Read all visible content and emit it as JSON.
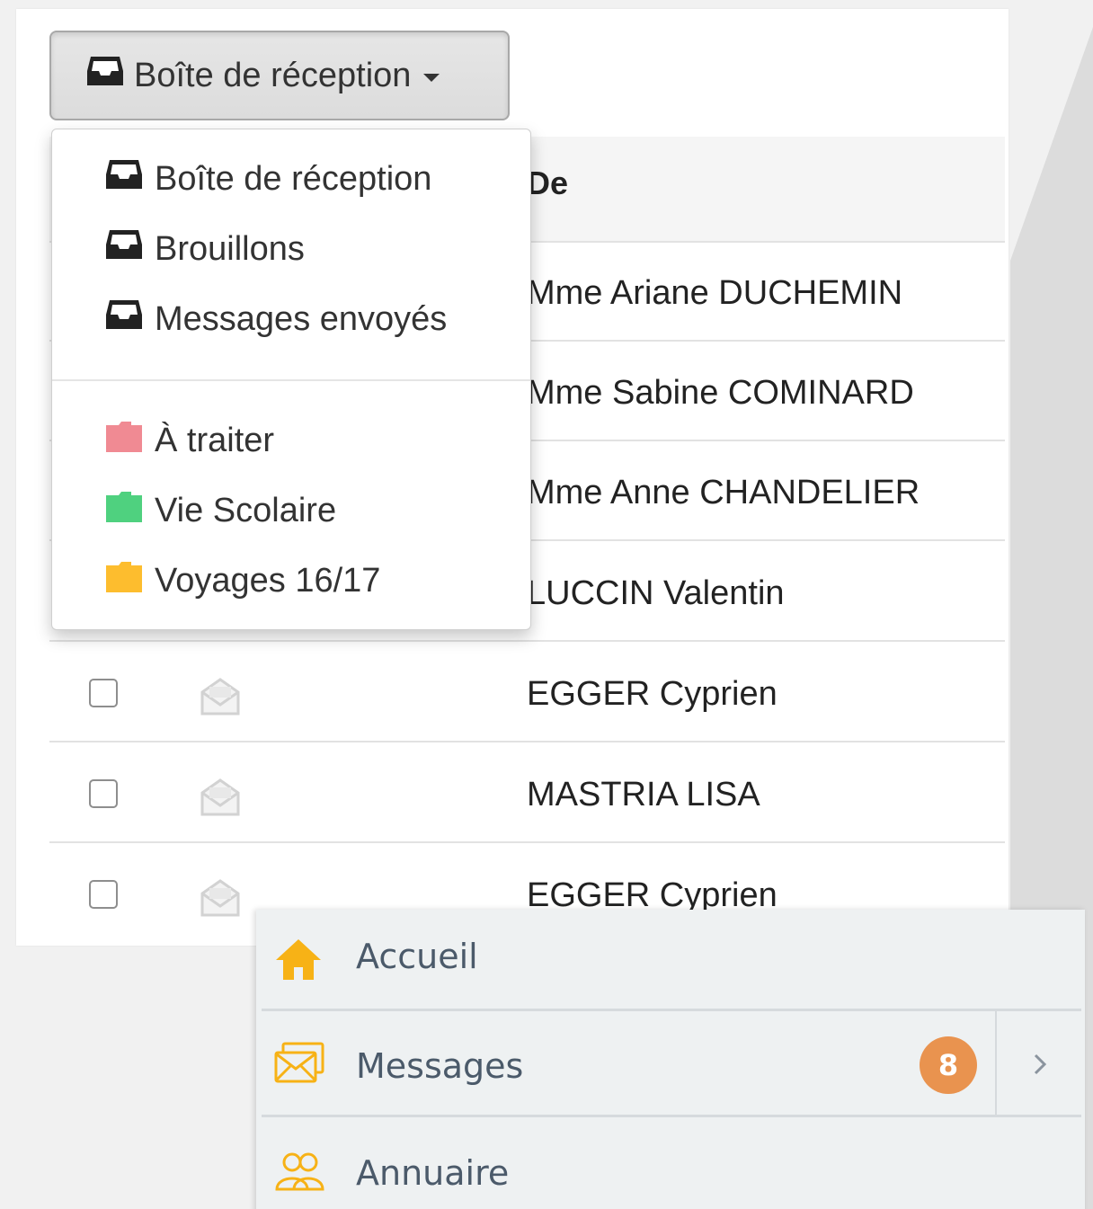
{
  "folder_button": {
    "label": "Boîte de réception"
  },
  "table": {
    "from_header": "De",
    "rows": [
      {
        "from": "Mme Ariane DUCHEMIN"
      },
      {
        "from": "Mme Sabine COMINARD"
      },
      {
        "from": "Mme Anne CHANDELIER"
      },
      {
        "from": "LUCCIN Valentin"
      },
      {
        "from": "EGGER Cyprien"
      },
      {
        "from": "MASTRIA LISA"
      },
      {
        "from": "EGGER Cyprien"
      }
    ]
  },
  "folder_menu": {
    "system_folders": [
      {
        "label": "Boîte de réception",
        "icon": "inbox-icon"
      },
      {
        "label": "Brouillons",
        "icon": "inbox-icon"
      },
      {
        "label": "Messages envoyés",
        "icon": "inbox-icon"
      }
    ],
    "custom_folders": [
      {
        "label": "À traiter",
        "icon": "folder-icon",
        "color": "#f08a93"
      },
      {
        "label": "Vie Scolaire",
        "icon": "folder-icon",
        "color": "#4fd17f"
      },
      {
        "label": "Voyages 16/17",
        "icon": "folder-icon",
        "color": "#fdbd2e"
      }
    ]
  },
  "nav": {
    "items": [
      {
        "label": "Accueil",
        "icon": "home-icon",
        "color": "#f7b216"
      },
      {
        "label": "Messages",
        "icon": "messages-icon",
        "color": "#f7b216",
        "badge": "8"
      },
      {
        "label": "Annuaire",
        "icon": "contacts-icon",
        "color": "#f7b216"
      }
    ]
  }
}
